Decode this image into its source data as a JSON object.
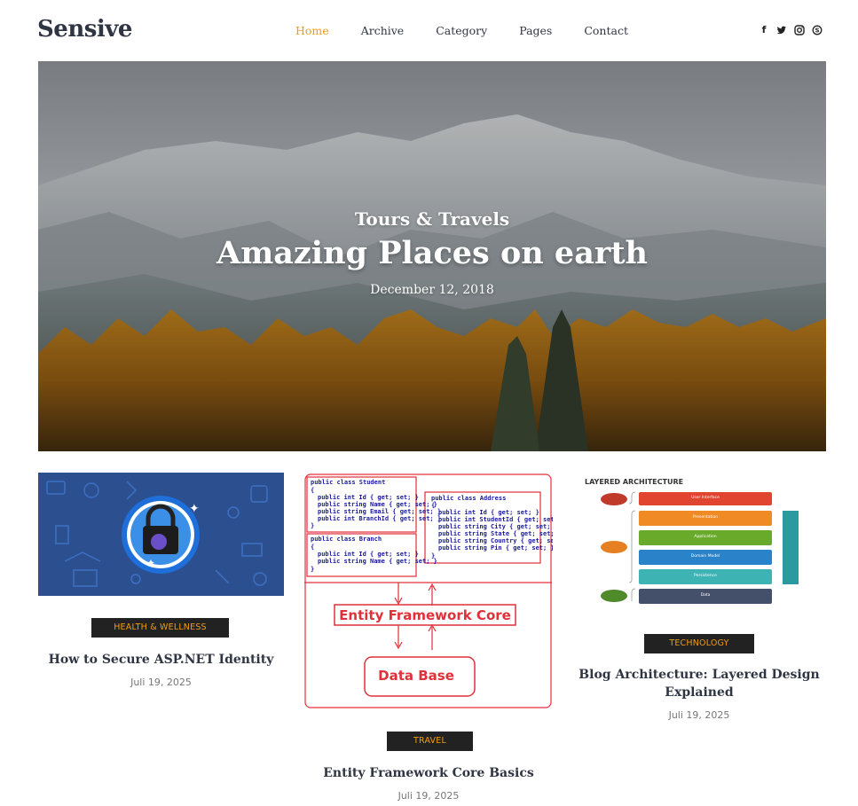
{
  "header": {
    "logo": "Sensive",
    "nav": [
      "Home",
      "Archive",
      "Category",
      "Pages",
      "Contact"
    ],
    "social_icons": [
      "facebook-icon",
      "twitter-icon",
      "instagram-icon",
      "skype-icon"
    ],
    "accent_color": "#f39c12"
  },
  "hero": {
    "category": "Tours & Travels",
    "title": "Amazing Places on earth",
    "date": "December 12, 2018"
  },
  "posts": [
    {
      "badge": "HEALTH & WELLNESS",
      "title": "How to Secure ASP.NET Identity",
      "date": "Juli 19, 2025"
    },
    {
      "badge": "TRAVEL",
      "title": "Entity Framework Core Basics",
      "date": "Juli 19, 2025",
      "diagram": {
        "student": [
          "public class Student",
          "{",
          "public int Id { get; set; }",
          "public string Name { get; set; }",
          "public string Email { get; set; }",
          "public int BranchId { get; set; }",
          "}"
        ],
        "branch": [
          "public class Branch",
          "{",
          "public int Id { get; set; }",
          "public string Name { get; set; }",
          "}"
        ],
        "address": [
          "public class Address",
          "{",
          "public int Id { get; set; }",
          "public int StudentId { get; set; }",
          "public string City { get; set; }",
          "public string State { get; set; }",
          "public string Country { get; set; }",
          "public string Pin { get; set; }",
          "}"
        ],
        "ef_label": "Entity Framework Core",
        "db_label": "Data Base"
      }
    },
    {
      "badge": "TECHNOLOGY",
      "title_line1": "Blog Architecture: Layered Design",
      "title_line2": "Explained",
      "date": "Juli 19, 2025",
      "diagram": {
        "heading": "LAYERED ARCHITECTURE",
        "layers": [
          "User Interface",
          "Presentation",
          "Application",
          "Domain Model",
          "Persistence",
          "Data"
        ]
      }
    }
  ]
}
